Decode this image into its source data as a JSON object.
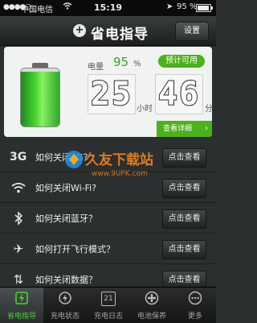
{
  "status_bar": {
    "signal": "●●●●○",
    "carrier": "中国电信",
    "wifi_icon": "wifi-icon",
    "time": "15:19",
    "location_icon": "location-arrow-icon",
    "battery_percent": "95 %"
  },
  "header": {
    "title": "省电指导",
    "settings_label": "设置",
    "logo_icon": "plus-circle-icon"
  },
  "status_card": {
    "level_label": "电量",
    "level_value": "95",
    "level_unit": "%",
    "level_fill": 0.95,
    "available_label": "预计可用",
    "hours": "25",
    "hours_unit": "小时",
    "minutes": "46",
    "minutes_unit": "分",
    "details_label": "查看详细"
  },
  "list": [
    {
      "icon": "3g-icon",
      "icon_text": "3G",
      "text": "如何关闭3G？",
      "button": "点击查看"
    },
    {
      "icon": "wifi-icon",
      "icon_text": "≋",
      "text": "如何关闭Wi-Fi?",
      "button": "点击查看"
    },
    {
      "icon": "bluetooth-icon",
      "icon_text": "ᛒ",
      "text": "如何关闭蓝牙？",
      "button": "点击查看"
    },
    {
      "icon": "airplane-icon",
      "icon_text": "✈",
      "text": "如何打开飞行模式？",
      "button": "点击查看"
    },
    {
      "icon": "data-icon",
      "icon_text": "⇅",
      "text": "如何关闭数据？",
      "button": "点击查看"
    }
  ],
  "watermark": "久友下载站",
  "watermark_url": "www.9UPK.com",
  "tabs": [
    {
      "label": "省电指导",
      "icon": "guide-icon",
      "glyph": "⚡",
      "active": true
    },
    {
      "label": "充电状态",
      "icon": "charge-status-icon",
      "glyph": "🔌",
      "active": false
    },
    {
      "label": "充电日志",
      "icon": "calendar-icon",
      "glyph": "21",
      "active": false
    },
    {
      "label": "电池保养",
      "icon": "battery-care-icon",
      "glyph": "✚",
      "active": false
    },
    {
      "label": "更多",
      "icon": "more-icon",
      "glyph": "•••",
      "active": false
    }
  ],
  "colors": {
    "accent_green": "#4ab21a",
    "level_green": "#35a22b",
    "tab_active": "#48d42a"
  }
}
